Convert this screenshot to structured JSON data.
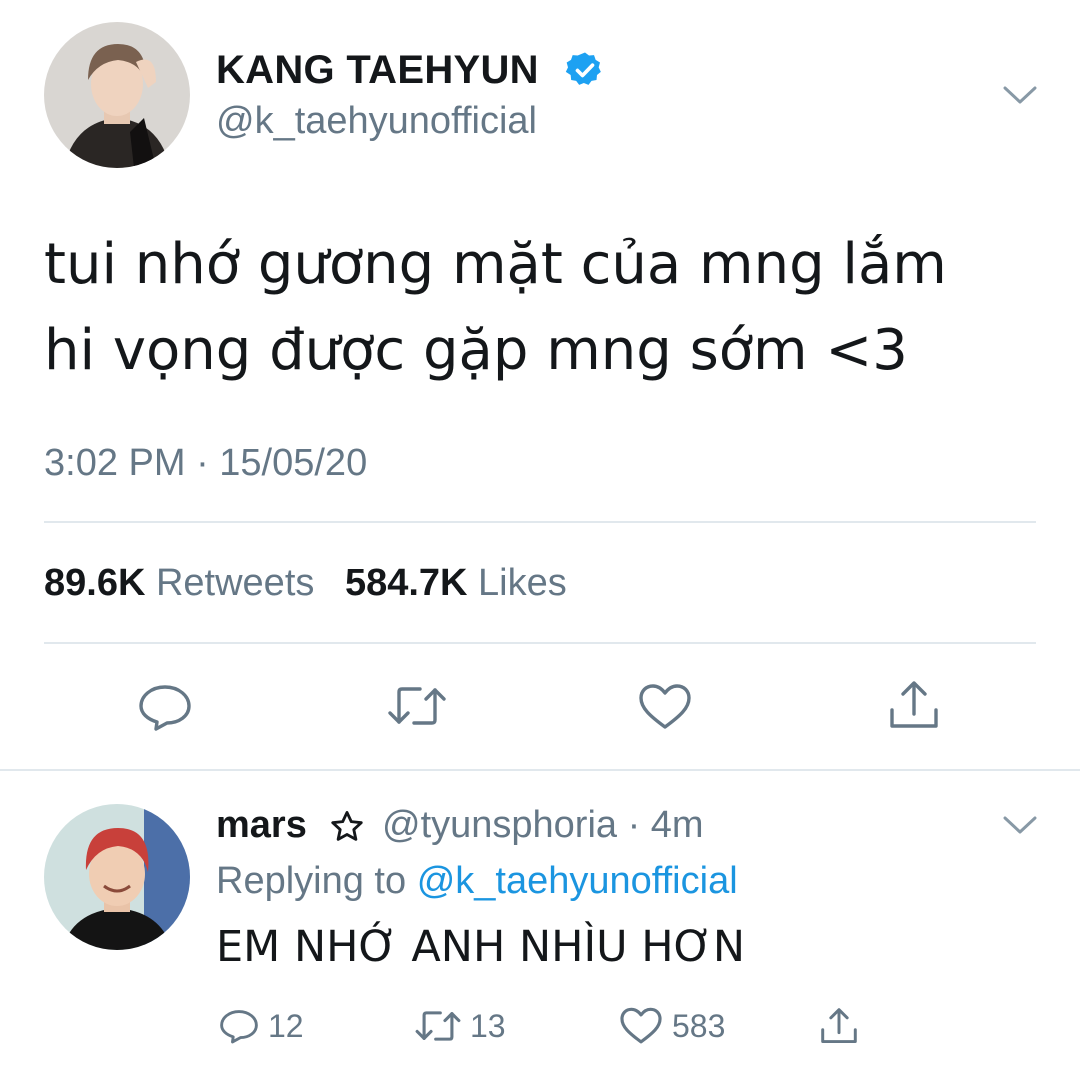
{
  "tweet": {
    "author": {
      "display_name": "KANG TAEHYUN",
      "handle": "@k_taehyunofficial",
      "verified": true
    },
    "text_lines": [
      "tui nhớ gương mặt của mng lắm",
      "hi vọng được gặp mng sớm <3"
    ],
    "timestamp": "3:02 PM · 15/05/20",
    "stats": {
      "retweets_count": "89.6K",
      "retweets_label": "Retweets",
      "likes_count": "584.7K",
      "likes_label": "Likes"
    },
    "actions": [
      "reply-icon",
      "retweet-icon",
      "like-icon",
      "share-icon"
    ]
  },
  "reply": {
    "author": {
      "display_name": "mars",
      "handle_time": "@tyunsphoria · 4m"
    },
    "replying_prefix": "Replying to",
    "replying_to": "@k_taehyunofficial",
    "text": "EM NHỚ ANH NHÌU HƠN",
    "counts": {
      "replies": "12",
      "retweets": "13",
      "likes": "583"
    }
  },
  "colors": {
    "text": "#14171a",
    "secondary": "#657786",
    "accent": "#1da1f2",
    "mention": "#1b95e0",
    "divider": "#e1e8ed"
  }
}
